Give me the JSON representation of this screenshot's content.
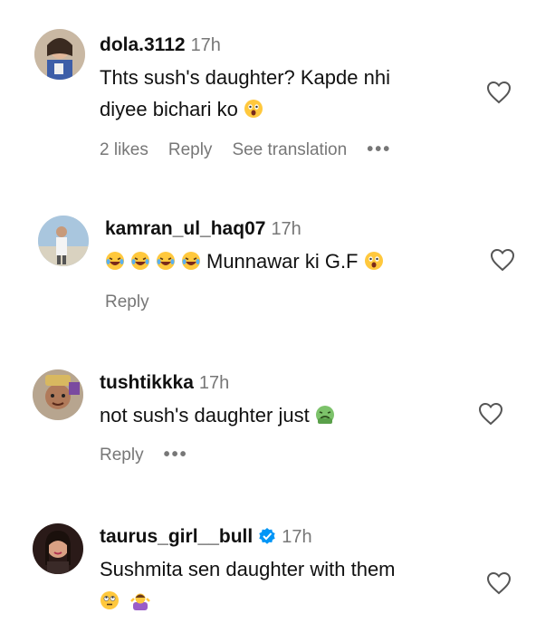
{
  "comments": [
    {
      "username": "dola.3112",
      "time": "17h",
      "text_line1": "Thts sush's daughter? Kapde nhi",
      "text_line2": "diyee bichari ko",
      "likes": "2 likes",
      "reply": "Reply",
      "translate": "See translation",
      "more": "•••"
    },
    {
      "username": "kamran_ul_haq07",
      "time": "17h",
      "text": "Munnawar ki G.F",
      "reply": "Reply"
    },
    {
      "username": "tushtikkka",
      "time": "17h",
      "text": "not sush's daughter just",
      "reply": "Reply",
      "more": "•••"
    },
    {
      "username": "taurus_girl__bull",
      "time": "17h",
      "text": "Sushmita sen daughter with them"
    }
  ],
  "colors": {
    "text": "#111111",
    "muted": "#777777",
    "verified": "#0095f6",
    "emoji_yellow": "#ffc83d"
  }
}
